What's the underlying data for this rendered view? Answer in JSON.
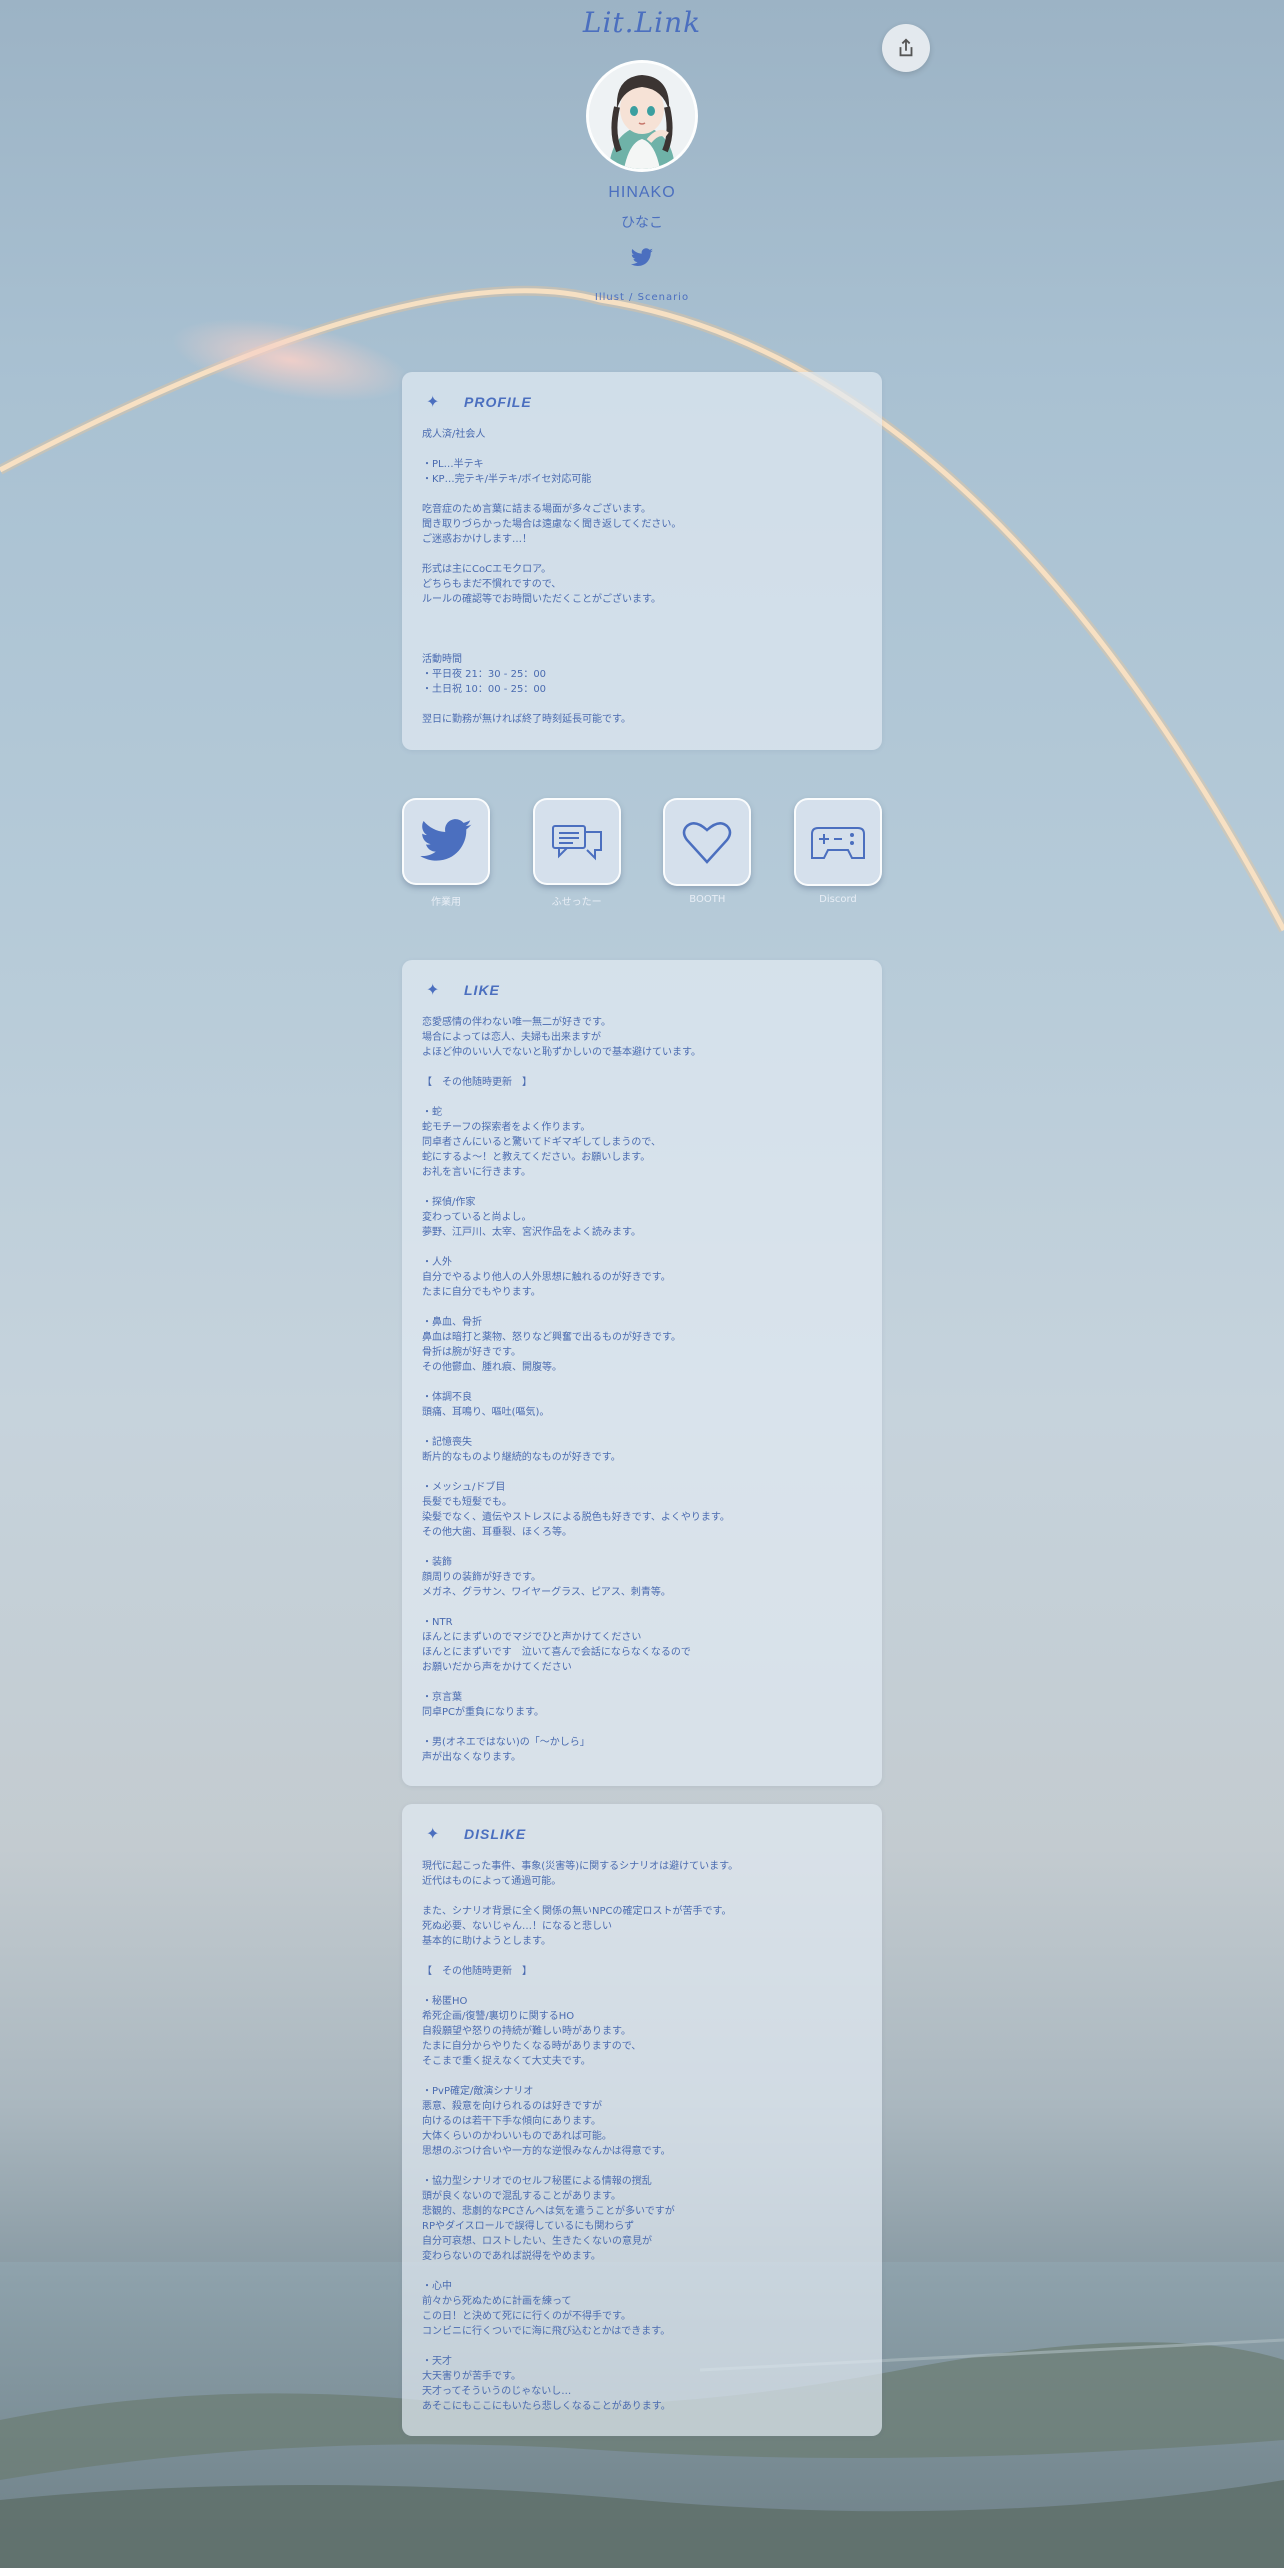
{
  "header": {
    "logo": "Lit.Link",
    "share_icon": "share-icon",
    "avatar_alt": "avatar",
    "name": "HINAKO",
    "name_kana": "ひなこ",
    "twitter_icon": "twitter-icon",
    "tagline": "Illust / Scenario"
  },
  "profile": {
    "title": "PROFILE",
    "star": "✦",
    "body": "成人済/社会人\n\n・PL…半テキ\n・KP…完テキ/半テキ/ボイセ対応可能\n\n吃音症のため言葉に詰まる場面が多々ございます。\n聞き取りづらかった場合は遠慮なく聞き返してください。\nご迷惑おかけします…！\n\n形式は主にCoCエモクロア。\nどちらもまだ不慣れですので、\nルールの確認等でお時間いただくことがございます。\n\n\n\n活動時間\n・平日夜 21：30 - 25：00\n・土日祝 10：00 - 25：00\n\n翌日に勤務が無ければ終了時刻延長可能です。"
  },
  "links": [
    {
      "label": "作業用",
      "icon": "twitter-icon"
    },
    {
      "label": "ふせったー",
      "icon": "chat-bubbles-icon"
    },
    {
      "label": "BOOTH",
      "icon": "heart-icon"
    },
    {
      "label": "Discord",
      "icon": "gamepad-icon"
    }
  ],
  "like": {
    "title": "LIKE",
    "star": "✦",
    "body": "恋愛感情の伴わない唯一無二が好きです。\n場合によっては恋人、夫婦も出来ますが\nよほど仲のいい人でないと恥ずかしいので基本避けています。\n\n【　その他随時更新　】\n\n・蛇\n蛇モチーフの探索者をよく作ります。\n同卓者さんにいると驚いてドギマギしてしまうので、\n蛇にするよ〜！と教えてください。お願いします。\nお礼を言いに行きます。\n\n・探偵/作家\n変わっていると尚よし。\n夢野、江戸川、太宰、宮沢作品をよく読みます。\n\n・人外\n自分でやるより他人の人外思想に触れるのが好きです。\nたまに自分でもやります。\n\n・鼻血、骨折\n鼻血は暗打と薬物、怒りなど興奮で出るものが好きです。\n骨折は腕が好きです。\nその他鬱血、腫れ痕、開腹等。\n\n・体調不良\n頭痛、耳鳴り、嘔吐(嘔気)。\n\n・記憶喪失\n断片的なものより継続的なものが好きです。\n\n・メッシュ/ドブ目\n長髪でも短髪でも。\n染髪でなく、遺伝やストレスによる脱色も好きです、よくやります。\nその他大歯、耳垂裂、ほくろ等。\n\n・装飾\n顔周りの装飾が好きです。\nメガネ、グラサン、ワイヤーグラス、ピアス、刺青等。\n\n・NTR\nほんとにまずいのでマジでひと声かけてください\nほんとにまずいです　泣いて喜んで会話にならなくなるので\nお願いだから声をかけてください\n\n・京言葉\n同卓PCが重負になります。\n\n・男(オネエではない)の「〜かしら」\n声が出なくなります。"
  },
  "dislike": {
    "title": "DISLIKE",
    "star": "✦",
    "body": "現代に起こった事件、事象(災害等)に関するシナリオは避けています。\n近代はものによって通過可能。\n\nまた、シナリオ背景に全く関係の無いNPCの確定ロストが苦手です。\n死ぬ必要、ないじゃん…！になると悲しい\n基本的に助けようとします。\n\n【　その他随時更新　】\n\n・秘匿HO\n希死企画/復讐/裏切りに関するHO\n自殺願望や怒りの持続が難しい時があります。\nたまに自分からやりたくなる時がありますので、\nそこまで重く捉えなくて大丈夫です。\n\n・PvP確定/敵演シナリオ\n悪意、殺意を向けられるのは好きですが\n向けるのは若干下手な傾向にあります。\n大体くらいのかわいいものであれば可能。\n思想のぶつけ合いや一方的な逆恨みなんかは得意です。\n\n・協力型シナリオでのセルフ秘匿による情報の撹乱\n頭が良くないので混乱することがあります。\n悲観的、悲劇的なPCさんへは気を遣うことが多いですが\nRPやダイスロールで誤得しているにも関わらず\n自分可哀想、ロストしたい、生きたくないの意見が\n変わらないのであれば説得をやめます。\n\n・心中\n前々から死ぬために計画を練って\nこの日！と決めて死にに行くのが不得手です。\nコンビニに行くついでに海に飛び込むとかはできます。\n\n・天才\n大天害りが苦手です。\n天才ってそういうのじゃないし…\nあそこにもここにもいたら悲しくなることがあります。"
  },
  "colors": {
    "accent": "#4b6fbf",
    "card_bg": "rgba(225,233,242,0.7)",
    "sky_top": "#9cb3c5",
    "ground": "#6f8088"
  }
}
